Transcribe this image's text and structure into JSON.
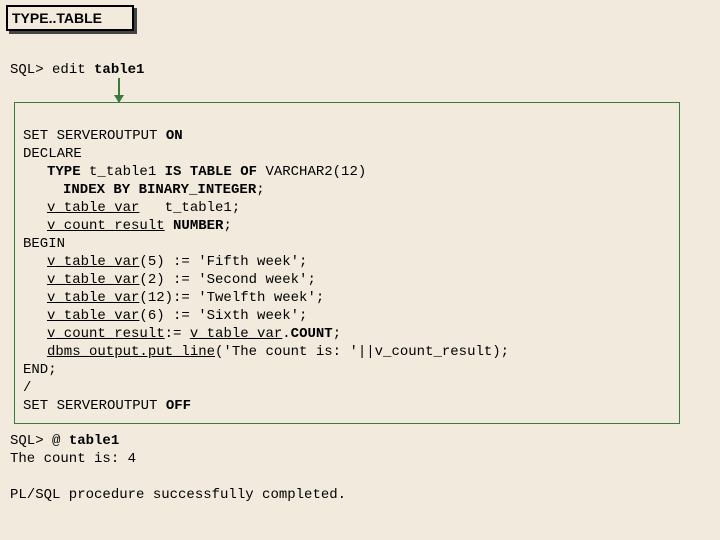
{
  "title": "TYPE..TABLE",
  "prompt": {
    "sql": "SQL> ",
    "edit": "edit ",
    "file": "table1"
  },
  "code": {
    "l1a": "SET SERVEROUTPUT ",
    "l1b": "ON",
    "l2": "DECLARE",
    "l3a": "TYPE",
    "l3b": " t_table1 ",
    "l3c": "IS TABLE OF",
    "l3d": " VARCHAR2(12)",
    "l4a": "INDEX BY BINARY_INTEGER",
    "l4b": ";",
    "l5a": "v_table_var",
    "l5b": "   t_table1;",
    "l6a": "v_count_result",
    "l6b": " ",
    "l6c": "NUMBER",
    "l6d": ";",
    "l7": "BEGIN",
    "l8a": "v_table_var",
    "l8b": "(5) := 'Fifth week';",
    "l9a": "v_table_var",
    "l9b": "(2) := 'Second week';",
    "l10a": "v_table_var",
    "l10b": "(12):= 'Twelfth week';",
    "l11a": "v_table_var",
    "l11b": "(6) := 'Sixth week';",
    "l12a": "v_count_result",
    "l12b": ":= ",
    "l12c": "v_table_var",
    "l12d": ".",
    "l12e": "COUNT",
    "l12f": ";",
    "l13a": "dbms_output.put_line",
    "l13b": "('The count is: '||v_count_result);",
    "l14": "END;",
    "l15": "/",
    "l16a": "SET SERVEROUTPUT ",
    "l16b": "OFF"
  },
  "out": {
    "l1a": "SQL> @ ",
    "l1b": "table1",
    "l2": "The count is: 4",
    "l3": "PL/SQL procedure successfully completed."
  }
}
